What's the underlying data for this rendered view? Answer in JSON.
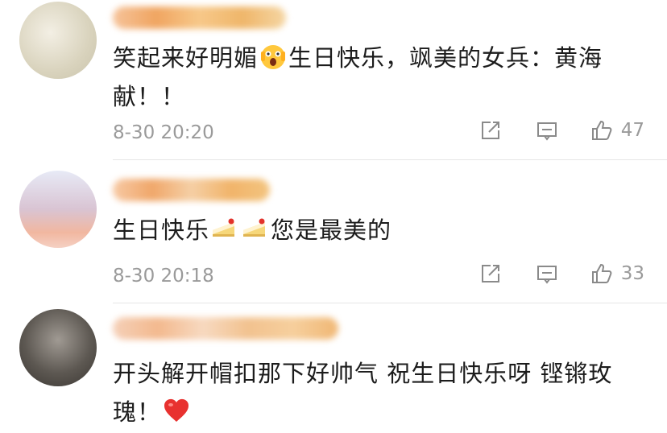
{
  "comments": [
    {
      "text_before": "笑起来好明媚",
      "text_after": "生日快乐，飒美的女兵：黄海献！！",
      "time": "8-30 20:20",
      "likes": "47",
      "emoji": [
        "scream-face-emoji"
      ]
    },
    {
      "text_before": "生日快乐",
      "text_after": "您是最美的",
      "time": "8-30 20:18",
      "likes": "33",
      "emoji": [
        "cake-emoji",
        "cake-emoji"
      ]
    },
    {
      "text_before": "开头解开帽扣那下好帅气 祝生日快乐呀 铿锵玫瑰！",
      "text_after": "",
      "emoji": [
        "heart-emoji"
      ]
    }
  ],
  "icons": {
    "share": "share-icon",
    "reply": "comment-icon",
    "like": "thumbs-up-icon"
  },
  "colors": {
    "meta_text": "#9a9a9a",
    "heart": "#e8312f"
  }
}
